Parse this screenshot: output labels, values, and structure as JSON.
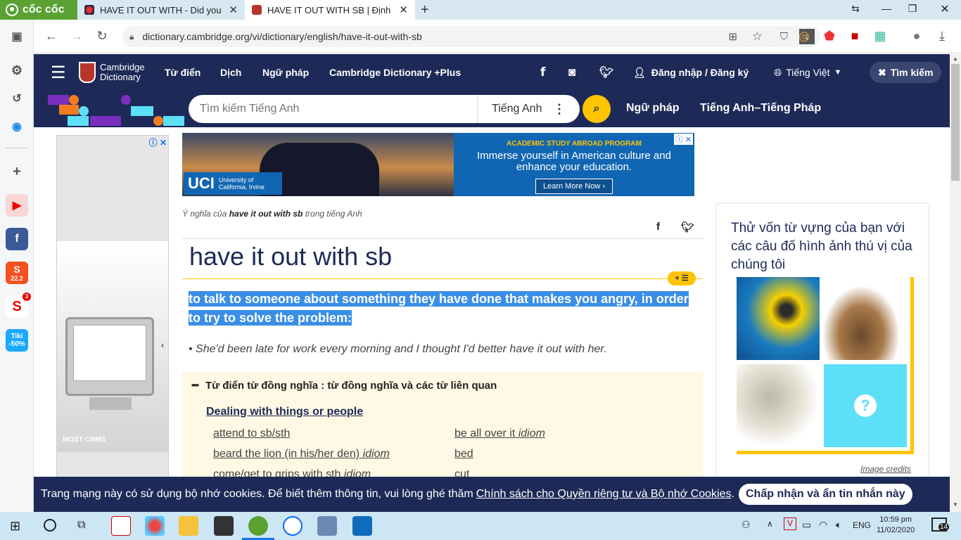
{
  "browser": {
    "brand": "cốc cốc",
    "tabs": [
      {
        "title": "HAVE IT OUT WITH - Did you"
      },
      {
        "title": "HAVE IT OUT WITH SB | Định"
      }
    ],
    "url": "dictionary.cambridge.org/vi/dictionary/english/have-it-out-with-sb"
  },
  "header": {
    "logo_line1": "Cambridge",
    "logo_line2": "Dictionary",
    "nav": [
      "Từ điển",
      "Dịch",
      "Ngữ pháp",
      "Cambridge Dictionary +Plus"
    ],
    "login": "Đăng nhập / Đăng ký",
    "language": "Tiếng Việt",
    "search_toggle": "Tìm kiếm"
  },
  "search": {
    "placeholder": "Tìm kiếm Tiếng Anh",
    "dictionary": "Tiếng Anh",
    "links": [
      "Ngữ pháp",
      "Tiếng Anh–Tiếng Pháp"
    ]
  },
  "ad_banner": {
    "logo": "UCI",
    "logo_sub": "University of California, Irvine",
    "heading": "ACADEMIC STUDY ABROAD PROGRAM",
    "body": "Immerse yourself in American culture and enhance your education.",
    "cta": "Learn More Now"
  },
  "left_ad": {
    "caption": "MOST CRMS"
  },
  "entry": {
    "crumb_pre": "Ý nghĩa của ",
    "crumb_word": "have it out with sb",
    "crumb_post": " trong tiếng Anh",
    "headword": "have it out with sb",
    "badge": "+ ☰",
    "definition": "to talk to someone about something they have done that makes you angry, in order to try to solve the problem:",
    "example": "She'd been late for work every morning and I thought I'd better have it out with her."
  },
  "synonyms": {
    "heading": "Từ điển từ đồng nghĩa : từ đồng nghĩa và các từ liên quan",
    "subheading": "Dealing with things or people",
    "col1": [
      {
        "text": "attend to sb/sth",
        "tag": ""
      },
      {
        "text": "beard the lion (in his/her den)",
        "tag": "idiom"
      },
      {
        "text": "come/get to grips with sth",
        "tag": "idiom"
      }
    ],
    "col2": [
      {
        "text": "be all over it",
        "tag": "idiom"
      },
      {
        "text": "bed",
        "tag": ""
      },
      {
        "text": "cut",
        "tag": ""
      }
    ]
  },
  "quiz": {
    "title": "Thử vốn từ vựng của bạn với các câu đố hình ảnh thú vị của chúng tôi",
    "question_mark": "?",
    "credits": "Image credits"
  },
  "cookie": {
    "text": "Trang mạng này có sử dụng bộ nhớ cookies. Để biết thêm thông tin, vui lòng ghé thăm",
    "link": "Chính sách cho Quyền riêng tư và Bộ nhớ Cookies",
    "period": ".",
    "button": "Chấp nhận và ẩn tin nhắn này"
  },
  "sidebar": {
    "shopee_badge": "22.2",
    "tiki_label": "Tiki",
    "tiki_sale": "-50%",
    "notif_count": "3"
  },
  "taskbar": {
    "lang": "ENG",
    "time": "10:59 pm",
    "date": "11/02/2020",
    "notifications": "14"
  },
  "colors": {
    "brand_navy": "#1d2a57",
    "accent_yellow": "#fec400",
    "highlight_blue": "#3a8ee6",
    "coccoc_green": "#5aa132"
  }
}
